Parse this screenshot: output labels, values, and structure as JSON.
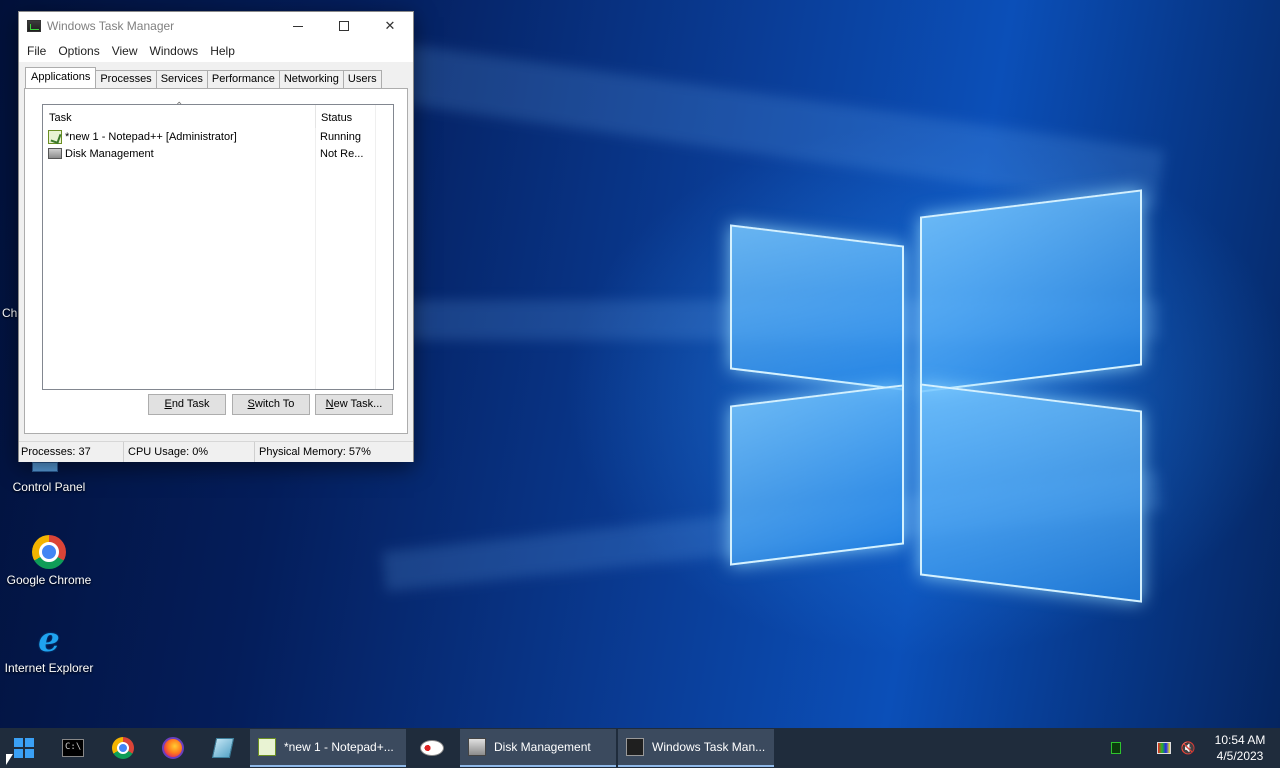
{
  "desktop": {
    "icons": [
      {
        "label": "Control Panel"
      },
      {
        "label": "Google Chrome"
      },
      {
        "label": "Internet Explorer"
      }
    ],
    "edge_label": "Ch"
  },
  "task_manager": {
    "title": "Windows Task Manager",
    "menu": [
      "File",
      "Options",
      "View",
      "Windows",
      "Help"
    ],
    "tabs": [
      "Applications",
      "Processes",
      "Services",
      "Performance",
      "Networking",
      "Users"
    ],
    "active_tab": "Applications",
    "columns": {
      "task": "Task",
      "status": "Status"
    },
    "rows": [
      {
        "task": "*new 1 - Notepad++ [Administrator]",
        "status": "Running",
        "icon": "notepadpp-icon"
      },
      {
        "task": "Disk Management",
        "status": "Not Re...",
        "icon": "disk-management-icon"
      }
    ],
    "buttons": {
      "end_task_pre": "",
      "end_task_u": "E",
      "end_task_post": "nd Task",
      "switch_pre": "",
      "switch_u": "S",
      "switch_post": "witch To",
      "new_pre": "",
      "new_u": "N",
      "new_post": "ew Task..."
    },
    "status_bar": {
      "processes": "Processes: 37",
      "cpu": "CPU Usage: 0%",
      "memory": "Physical Memory: 57%"
    }
  },
  "taskbar": {
    "tasks": [
      {
        "label": "*new 1 - Notepad+..."
      },
      {
        "label": "Disk Management"
      },
      {
        "label": "Windows Task Man..."
      }
    ],
    "clock": {
      "time": "10:54 AM",
      "date": "4/5/2023"
    },
    "cmd_glyph": "C:\\"
  },
  "colors": {
    "taskbar_bg": "#1f2c3c",
    "window_bg": "#f0f0f0",
    "accent": "#3aa0f5"
  }
}
